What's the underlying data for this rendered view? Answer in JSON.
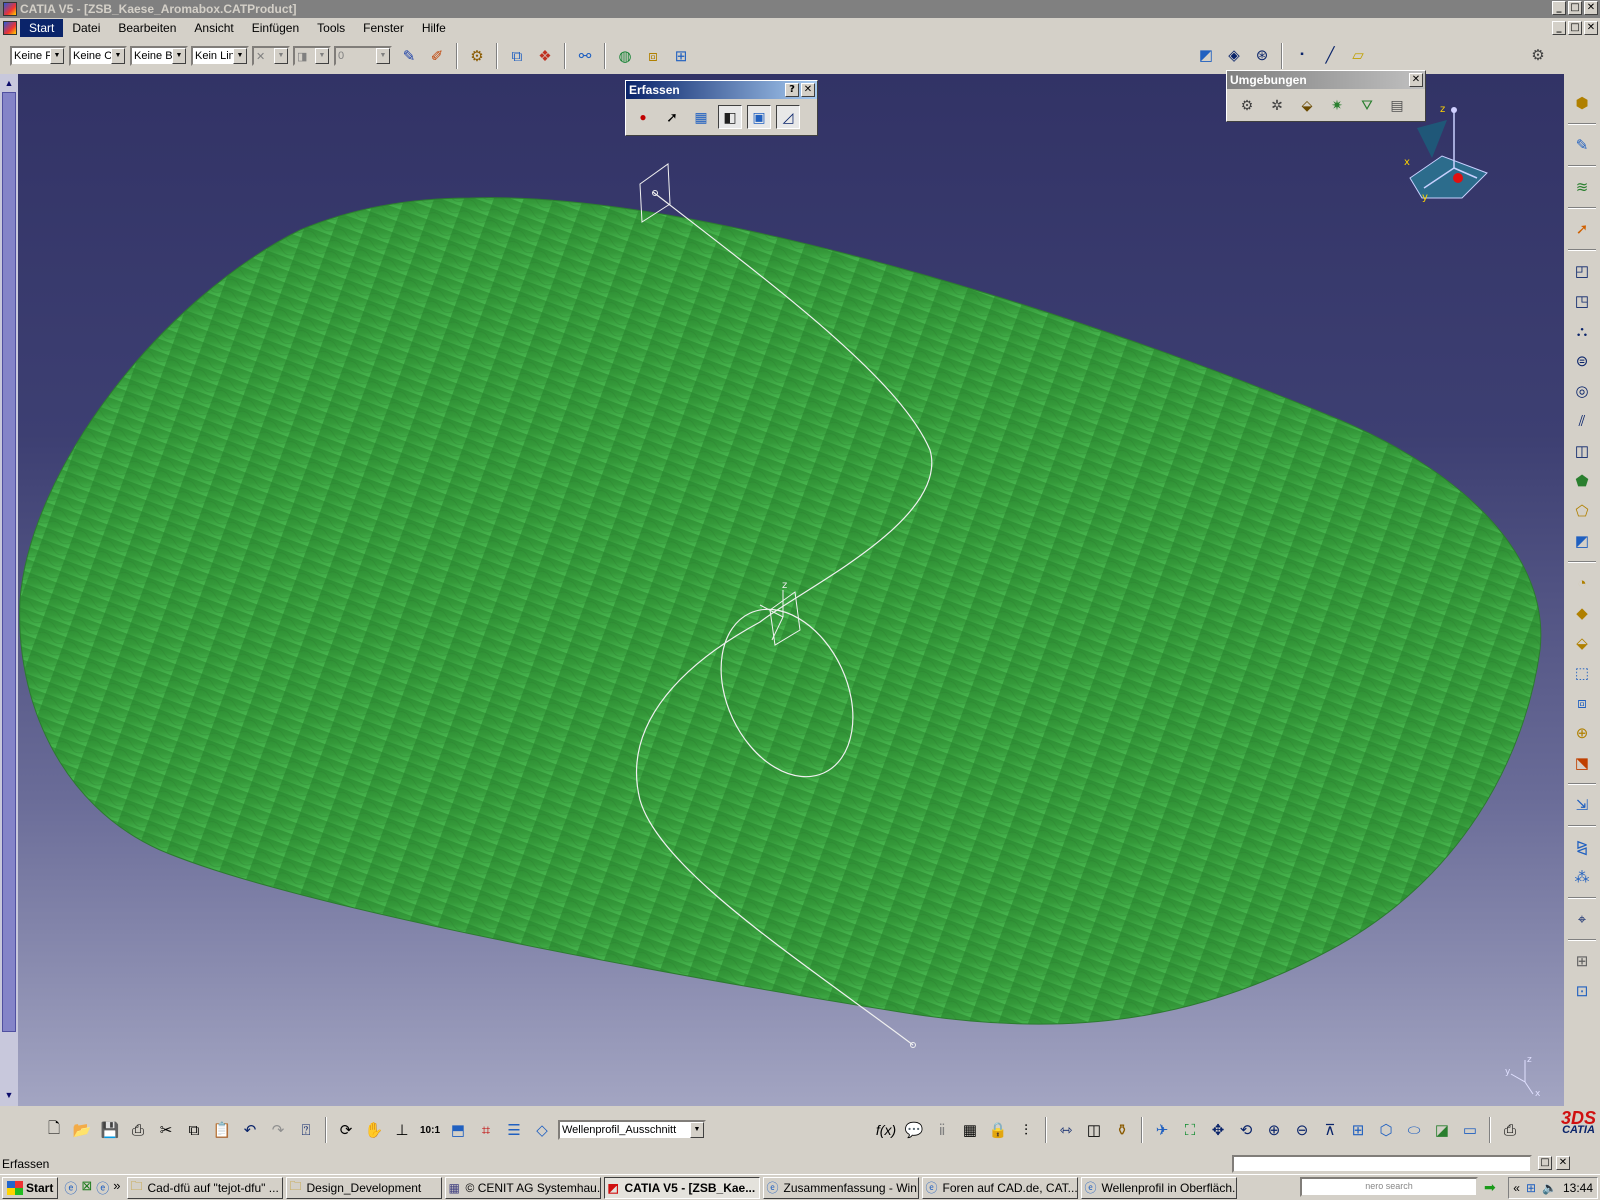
{
  "window": {
    "title": "CATIA V5 - [ZSB_Kaese_Aromabox.CATProduct]",
    "controls": {
      "minimize": "_",
      "maximize": "□",
      "close": "✕"
    }
  },
  "menu": {
    "items": [
      "Start",
      "Datei",
      "Bearbeiten",
      "Ansicht",
      "Einfügen",
      "Tools",
      "Fenster",
      "Hilfe"
    ]
  },
  "toolbar_top": {
    "combos": [
      "Keine F",
      "Keine O",
      "Keine B",
      "Kein Lin"
    ],
    "weight_value": "0"
  },
  "palette_erfassen": {
    "title": "Erfassen",
    "help": "?",
    "close": "✕"
  },
  "palette_umgebungen": {
    "title": "Umgebungen",
    "close": "✕"
  },
  "compass": {
    "z_label": "z",
    "x_label": "x",
    "y_label": "y"
  },
  "axis": {
    "origin_z": "z",
    "corner_z": "z",
    "corner_y": "y",
    "corner_x": "x"
  },
  "toolbar_bottom": {
    "view_selector": "Wellenprofil_Ausschnitt",
    "fx_label": "f(x)",
    "logo_text": "CATIA",
    "logo_mark": "3DS"
  },
  "status": {
    "text": "Erfassen"
  },
  "taskbar": {
    "start": "Start",
    "more": "»",
    "tasks": [
      {
        "label": "Cad-dfü auf \"tejot-dfu\" ...",
        "icon": "folder-icon"
      },
      {
        "label": "Design_Development",
        "icon": "folder-icon"
      },
      {
        "label": "© CENIT AG Systemhau...",
        "icon": "catia-icon"
      },
      {
        "label": "CATIA V5 - [ZSB_Kae...",
        "icon": "catia-icon",
        "active": true
      },
      {
        "label": "Zusammenfassung - Win...",
        "icon": "ie-icon"
      },
      {
        "label": "Foren auf CAD.de, CAT...",
        "icon": "ie-icon"
      },
      {
        "label": "Wellenprofil in Oberfläch...",
        "icon": "ie-icon"
      }
    ],
    "search_hint": "nero search",
    "clock": "13:44",
    "tray_chevron": "«"
  },
  "colors": {
    "surface_green": "#3a9e3c",
    "background_top": "#323366",
    "background_bottom": "#a3a5c2",
    "title_active": "#0a246a"
  }
}
